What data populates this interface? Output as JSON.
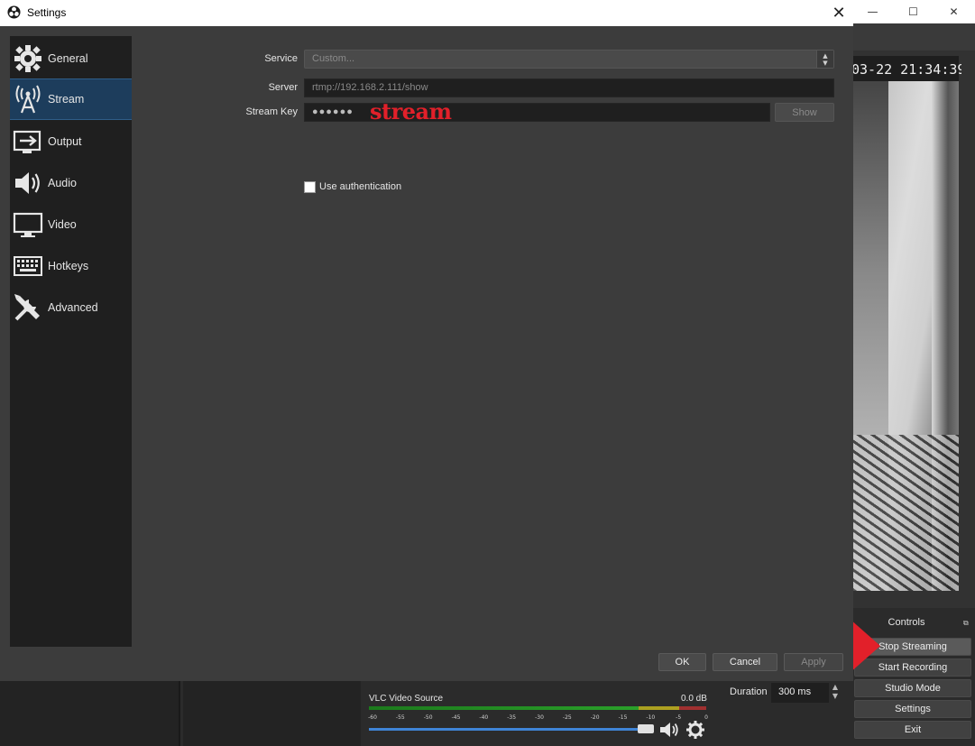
{
  "settings": {
    "title": "Settings",
    "close_glyph": "✕",
    "nav": [
      {
        "label": "General",
        "icon": "gear-icon"
      },
      {
        "label": "Stream",
        "icon": "broadcast-antenna-icon",
        "active": true
      },
      {
        "label": "Output",
        "icon": "output-icon"
      },
      {
        "label": "Audio",
        "icon": "speaker-icon"
      },
      {
        "label": "Video",
        "icon": "monitor-icon"
      },
      {
        "label": "Hotkeys",
        "icon": "keyboard-icon"
      },
      {
        "label": "Advanced",
        "icon": "tools-icon"
      }
    ],
    "form": {
      "service_label": "Service",
      "service_value": "Custom...",
      "server_label": "Server",
      "server_value": "rtmp://192.168.2.111/show",
      "streamkey_label": "Stream Key",
      "streamkey_value": "●●●●●●",
      "streamkey_annotation": "stream",
      "show_label": "Show",
      "auth_label": "Use authentication",
      "auth_checked": false
    },
    "buttons": {
      "ok": "OK",
      "cancel": "Cancel",
      "apply": "Apply"
    }
  },
  "obs": {
    "window_controls": {
      "minimize": "—",
      "maximize": "☐",
      "close": "✕"
    },
    "preview_timestamp": "03-22 21:34:39",
    "controls": {
      "title": "Controls",
      "float_glyph": "⧉",
      "stop_streaming": "Stop Streaming",
      "start_recording": "Start Recording",
      "studio_mode": "Studio Mode",
      "settings": "Settings",
      "exit": "Exit"
    },
    "transitions": {
      "duration_label": "Duration",
      "duration_value": "300 ms"
    },
    "mixer": {
      "source_name": "VLC Video Source",
      "level_db": "0.0 dB",
      "ticks": [
        "-60",
        "-55",
        "-50",
        "-45",
        "-40",
        "-35",
        "-30",
        "-25",
        "-20",
        "-15",
        "-10",
        "-5",
        "0"
      ],
      "volume": 1.0
    }
  },
  "colors": {
    "accent_selected": "#1d3d5c",
    "annotation_red": "#e2202a",
    "volume_blue": "#3f84d6"
  }
}
